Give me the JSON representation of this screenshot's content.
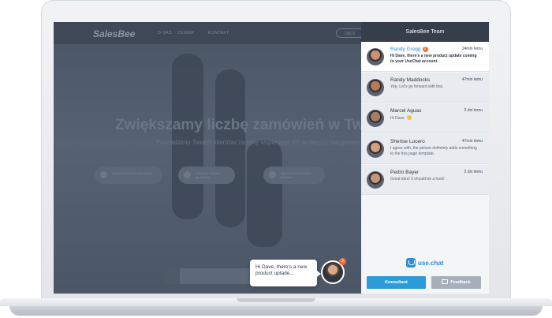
{
  "website": {
    "logo": "SalesBee",
    "nav_links": [
      "O NAS",
      "CENNIK",
      "KONTAKT"
    ],
    "nav_pill": "ZALO",
    "hero_title": "Zwiększamy liczbę zamówień w Twoim sk",
    "hero_subtitle": "Prowadzimy Twoich klientów za rękę wspierając ich w decyzji zakupowej",
    "features": [
      "Zwiększenie ilości zamówień",
      "Wirtualny asystent sprzedaży",
      "Uproszczony kontakt z klientem"
    ]
  },
  "bubble": {
    "text": "Hi Dave, there's a new product uptade...",
    "badge": "2"
  },
  "panel": {
    "title": "SalesBee Team",
    "conversations": [
      {
        "name": "Randy Gregg",
        "unread": "2",
        "time": "24min temu",
        "message": "Hi Dave, there's a new product update coming to your UseChat account.",
        "active": true,
        "avatar_color": "#c89274"
      },
      {
        "name": "Randy Maddocks",
        "unread": "",
        "time": "47min temu",
        "message": "Yep, Let's go forward with this.",
        "active": false,
        "avatar_color": "#b67a5c"
      },
      {
        "name": "Marcel Aguas",
        "unread": "",
        "time": "2 dni temu",
        "message": "Hi Dave",
        "active": false,
        "avatar_color": "#a67c63",
        "emoji": true
      },
      {
        "name": "Sherise Lucero",
        "unread": "",
        "time": "47min temu",
        "message": "I agree with, the picture definitely adds something to the this page template.",
        "active": false,
        "avatar_color": "#d2a07f"
      },
      {
        "name": "Pedro Bayer",
        "unread": "",
        "time": "2 dni temu",
        "message": "Great idea! It should be a hoot!",
        "active": false,
        "avatar_color": "#c4957a"
      }
    ],
    "brand": "use.chat",
    "consultant_label": "Konsultant",
    "feedback_label": "Feedback"
  }
}
